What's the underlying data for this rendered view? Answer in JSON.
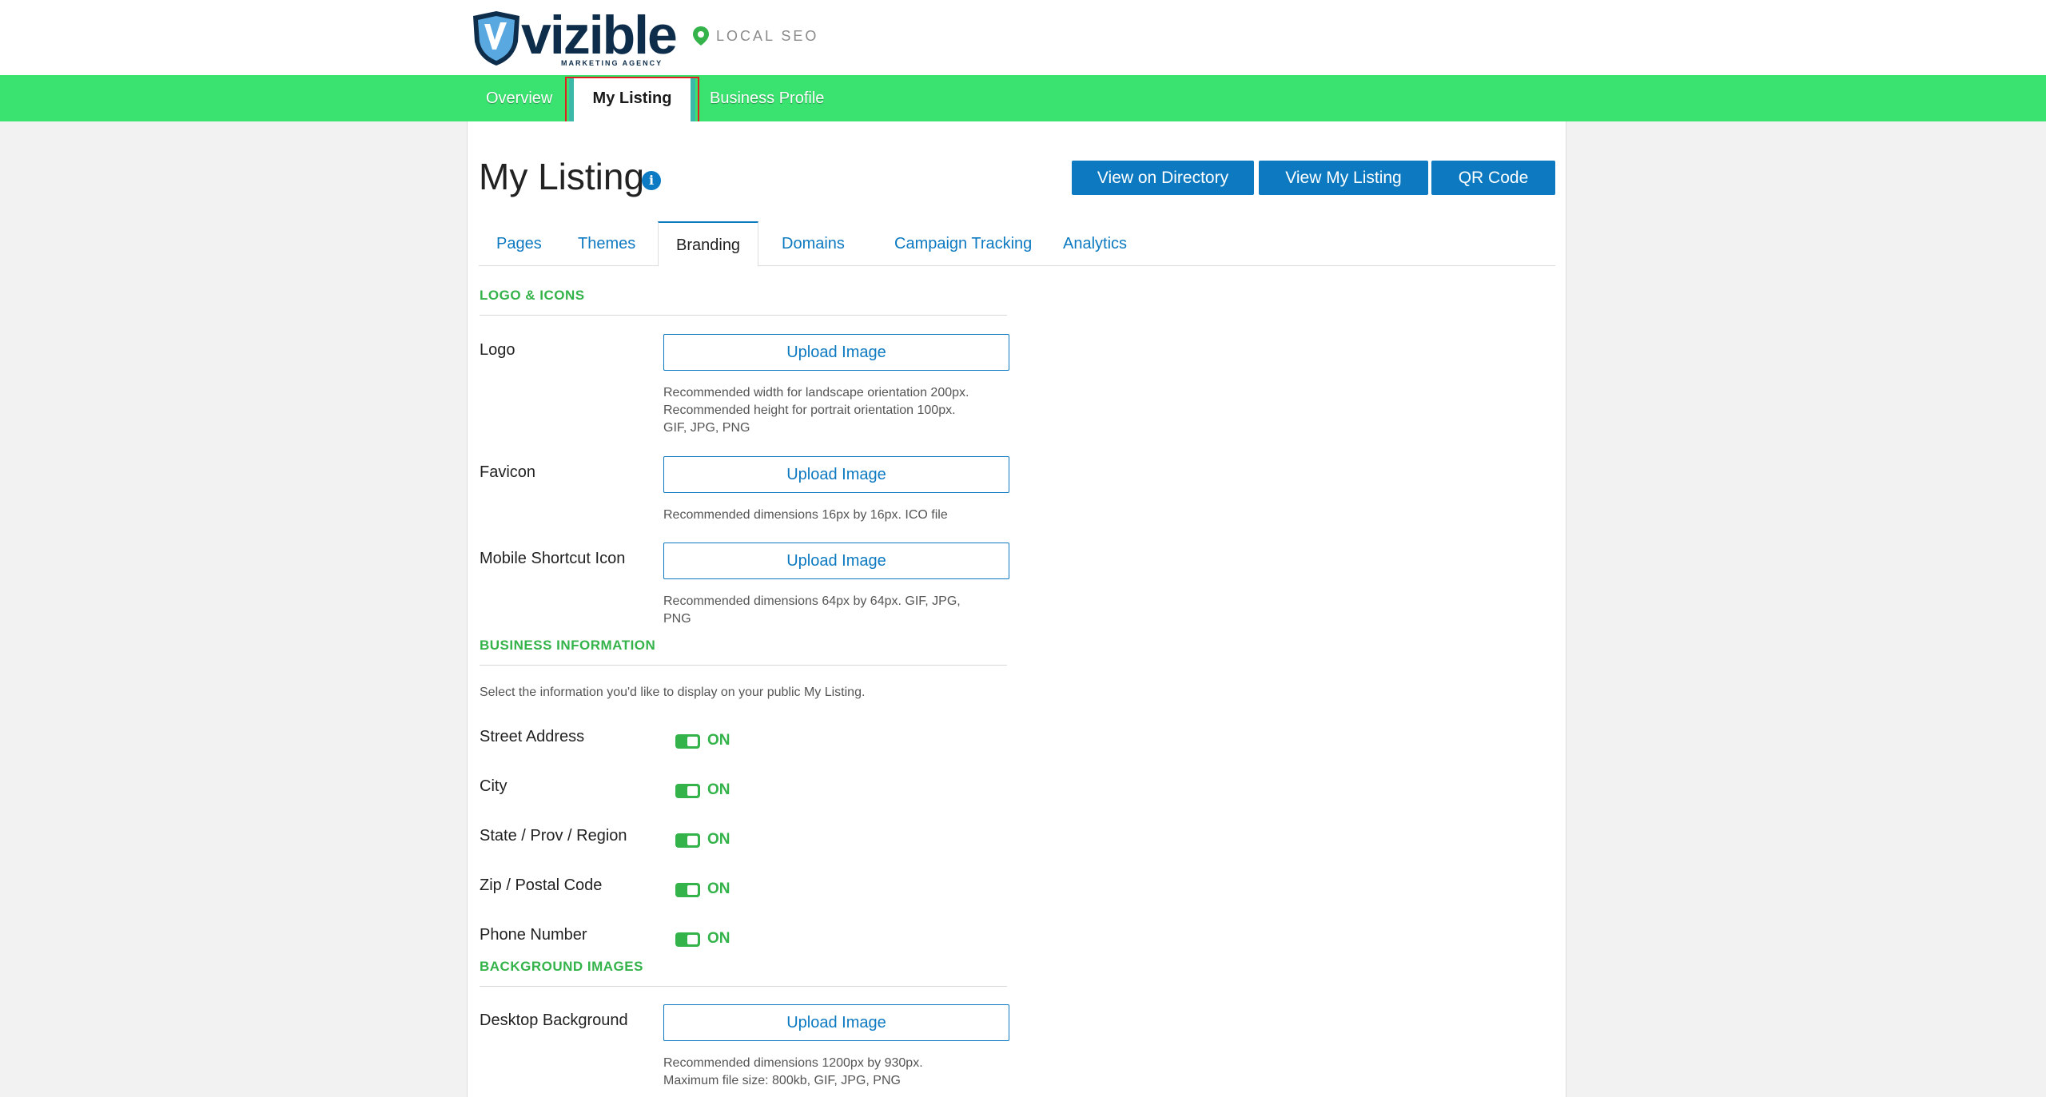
{
  "brand": {
    "logo_word": "vizible",
    "logo_tagline": "MARKETING AGENCY",
    "product_label": "LOCAL SEO",
    "accent_green": "#3ae36f",
    "accent_blue": "#0c79c1"
  },
  "nav": {
    "items": [
      {
        "label": "Overview"
      },
      {
        "label": "My Listing",
        "active": true
      },
      {
        "label": "Business Profile"
      }
    ]
  },
  "page": {
    "title": "My Listing",
    "info_icon_glyph": "i",
    "actions": {
      "view_on_directory": "View on Directory",
      "view_my_listing": "View My Listing",
      "qr_code": "QR Code"
    },
    "tabs": [
      {
        "label": "Pages"
      },
      {
        "label": "Themes"
      },
      {
        "label": "Branding",
        "active": true
      },
      {
        "label": "Domains"
      },
      {
        "label": "Campaign Tracking"
      },
      {
        "label": "Analytics"
      }
    ]
  },
  "logo_icons": {
    "heading": "LOGO & ICONS",
    "logo": {
      "label": "Logo",
      "button": "Upload Image",
      "help": [
        "Recommended width for landscape orientation 200px.",
        "Recommended height for portrait orientation 100px.",
        "GIF, JPG, PNG"
      ]
    },
    "favicon": {
      "label": "Favicon",
      "button": "Upload Image",
      "help": [
        "Recommended dimensions 16px by 16px. ICO file"
      ]
    },
    "mobile_icon": {
      "label": "Mobile Shortcut Icon",
      "button": "Upload Image",
      "help": [
        "Recommended dimensions 64px by 64px. GIF, JPG,",
        "PNG"
      ]
    }
  },
  "business_info": {
    "heading": "BUSINESS INFORMATION",
    "intro": "Select the information you'd like to display on your public My Listing.",
    "toggles": [
      {
        "label": "Street Address",
        "state": "ON"
      },
      {
        "label": "City",
        "state": "ON"
      },
      {
        "label": "State / Prov / Region",
        "state": "ON"
      },
      {
        "label": "Zip / Postal Code",
        "state": "ON"
      },
      {
        "label": "Phone Number",
        "state": "ON"
      }
    ]
  },
  "background_images": {
    "heading": "BACKGROUND IMAGES",
    "desktop": {
      "label": "Desktop Background",
      "button": "Upload Image",
      "help": [
        "Recommended dimensions 1200px by 930px.",
        "Maximum file size: 800kb, GIF, JPG, PNG"
      ]
    }
  }
}
